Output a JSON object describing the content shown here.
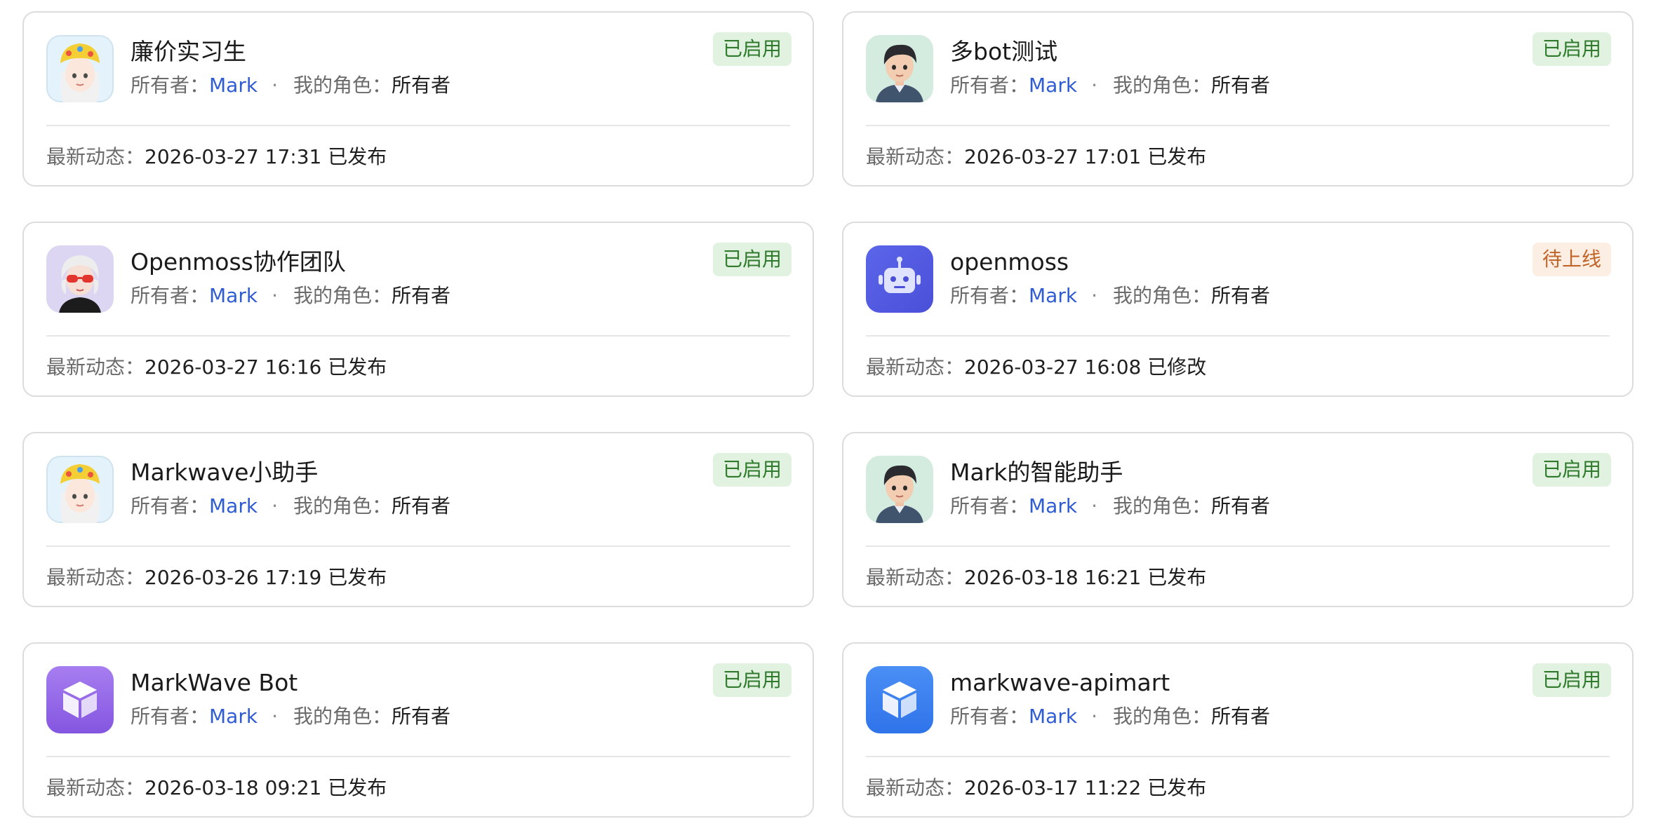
{
  "labels": {
    "owner_prefix": "所有者：",
    "role_prefix": "我的角色：",
    "activity_prefix": "最新动态：",
    "separator": "·"
  },
  "colors": {
    "status_active_bg": "#e1f3e0",
    "status_active_text": "#2f7a2c",
    "status_pending_bg": "#fdeee3",
    "status_pending_text": "#c1652b",
    "owner_link": "#2f5bd3"
  },
  "cards": [
    {
      "name": "廉价实习生",
      "status": "已启用",
      "owner": "Mark",
      "role": "所有者",
      "activity": "2026-03-27 17:31 已发布",
      "avatar": "girl-yellow-hat-avatar"
    },
    {
      "name": "多bot测试",
      "status": "已启用",
      "owner": "Mark",
      "role": "所有者",
      "activity": "2026-03-27 17:01 已发布",
      "avatar": "boy-avatar"
    },
    {
      "name": "Openmoss协作团队",
      "status": "已启用",
      "owner": "Mark",
      "role": "所有者",
      "activity": "2026-03-27 16:16 已发布",
      "avatar": "girl-red-glasses-avatar"
    },
    {
      "name": "openmoss",
      "status": "待上线",
      "owner": "Mark",
      "role": "所有者",
      "activity": "2026-03-27 16:08 已修改",
      "avatar": "robot-avatar"
    },
    {
      "name": "Markwave小助手",
      "status": "已启用",
      "owner": "Mark",
      "role": "所有者",
      "activity": "2026-03-26 17:19 已发布",
      "avatar": "girl-yellow-hat-avatar"
    },
    {
      "name": "Mark的智能助手",
      "status": "已启用",
      "owner": "Mark",
      "role": "所有者",
      "activity": "2026-03-18 16:21 已发布",
      "avatar": "boy-avatar"
    },
    {
      "name": "MarkWave Bot",
      "status": "已启用",
      "owner": "Mark",
      "role": "所有者",
      "activity": "2026-03-18 09:21 已发布",
      "avatar": "purple-cube-avatar"
    },
    {
      "name": "markwave-apimart",
      "status": "已启用",
      "owner": "Mark",
      "role": "所有者",
      "activity": "2026-03-17 11:22 已发布",
      "avatar": "blue-cube-avatar"
    }
  ]
}
